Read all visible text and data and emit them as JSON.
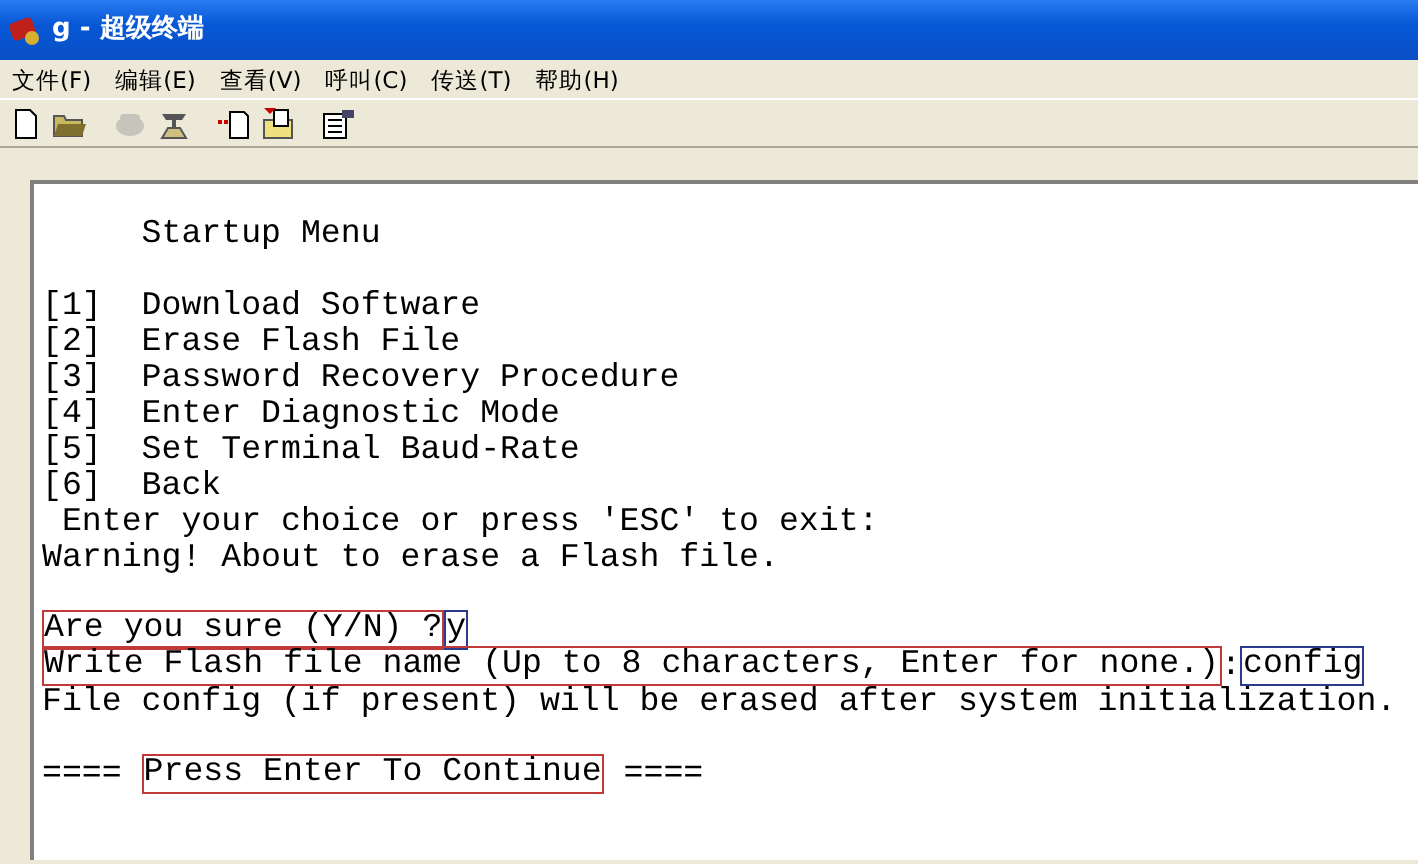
{
  "window": {
    "title": "g - 超级终端"
  },
  "menu": [
    {
      "label": "文件(F)"
    },
    {
      "label": "编辑(E)"
    },
    {
      "label": "查看(V)"
    },
    {
      "label": "呼叫(C)"
    },
    {
      "label": "传送(T)"
    },
    {
      "label": "帮助(H)"
    }
  ],
  "toolbar": [
    {
      "kind": "new",
      "disabled": false
    },
    {
      "kind": "open",
      "disabled": false
    },
    {
      "kind": "call",
      "disabled": true
    },
    {
      "kind": "hangup",
      "disabled": false
    },
    {
      "kind": "send",
      "disabled": false
    },
    {
      "kind": "receive",
      "disabled": false
    },
    {
      "kind": "properties",
      "disabled": false
    }
  ],
  "terminal": {
    "blocks": [
      [
        [
          {
            "text": "     Startup Menu"
          }
        ]
      ],
      [
        [
          {
            "text": "[1]  Download Software"
          }
        ],
        [
          {
            "text": "[2]  Erase Flash File"
          }
        ],
        [
          {
            "text": "[3]  Password Recovery Procedure"
          }
        ],
        [
          {
            "text": "[4]  Enter Diagnostic Mode"
          }
        ],
        [
          {
            "text": "[5]  Set Terminal Baud-Rate"
          }
        ],
        [
          {
            "text": "[6]  Back"
          }
        ],
        [
          {
            "text": " Enter your choice or press 'ESC' to exit:"
          }
        ],
        [
          {
            "text": "Warning! About to erase a Flash file."
          }
        ]
      ],
      [
        [
          {
            "text": "Are you sure (Y/N) ?",
            "color": "#c0393b"
          },
          {
            "text": "y",
            "color": "#2a3a8c"
          }
        ],
        [
          {
            "text": "Write Flash file name (Up to 8 characters, Enter for none.)",
            "color": "#c0393b"
          },
          {
            "text": ":"
          },
          {
            "text": "config",
            "color": "#2a3a8c"
          }
        ],
        [
          {
            "text": "File config (if present) will be erased after system initialization."
          }
        ]
      ],
      [
        [
          {
            "text": "==== "
          },
          {
            "text": "Press Enter To Continue",
            "color": "#c0393b"
          },
          {
            "text": " ===="
          }
        ]
      ]
    ]
  }
}
